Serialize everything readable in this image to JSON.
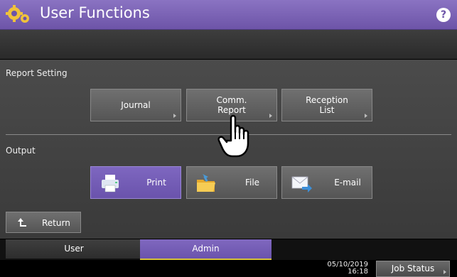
{
  "header": {
    "title": "User Functions",
    "help_label": "?"
  },
  "report_setting": {
    "section_label": "Report Setting",
    "buttons": [
      {
        "label": "Journal"
      },
      {
        "label": "Comm.\nReport"
      },
      {
        "label": "Reception\nList"
      }
    ]
  },
  "output": {
    "section_label": "Output",
    "buttons": [
      {
        "label": "Print",
        "icon": "printer-icon",
        "selected": true
      },
      {
        "label": "File",
        "icon": "folder-icon",
        "selected": false
      },
      {
        "label": "E-mail",
        "icon": "envelope-icon",
        "selected": false
      }
    ]
  },
  "return_label": "Return",
  "tabs": {
    "user": "User",
    "admin": "Admin",
    "active": "Admin"
  },
  "status": {
    "date": "05/10/2019",
    "time": "16:18",
    "job_status_label": "Job Status"
  },
  "colors": {
    "accent": "#7a62bb",
    "tab_underline": "#d8c43a"
  }
}
